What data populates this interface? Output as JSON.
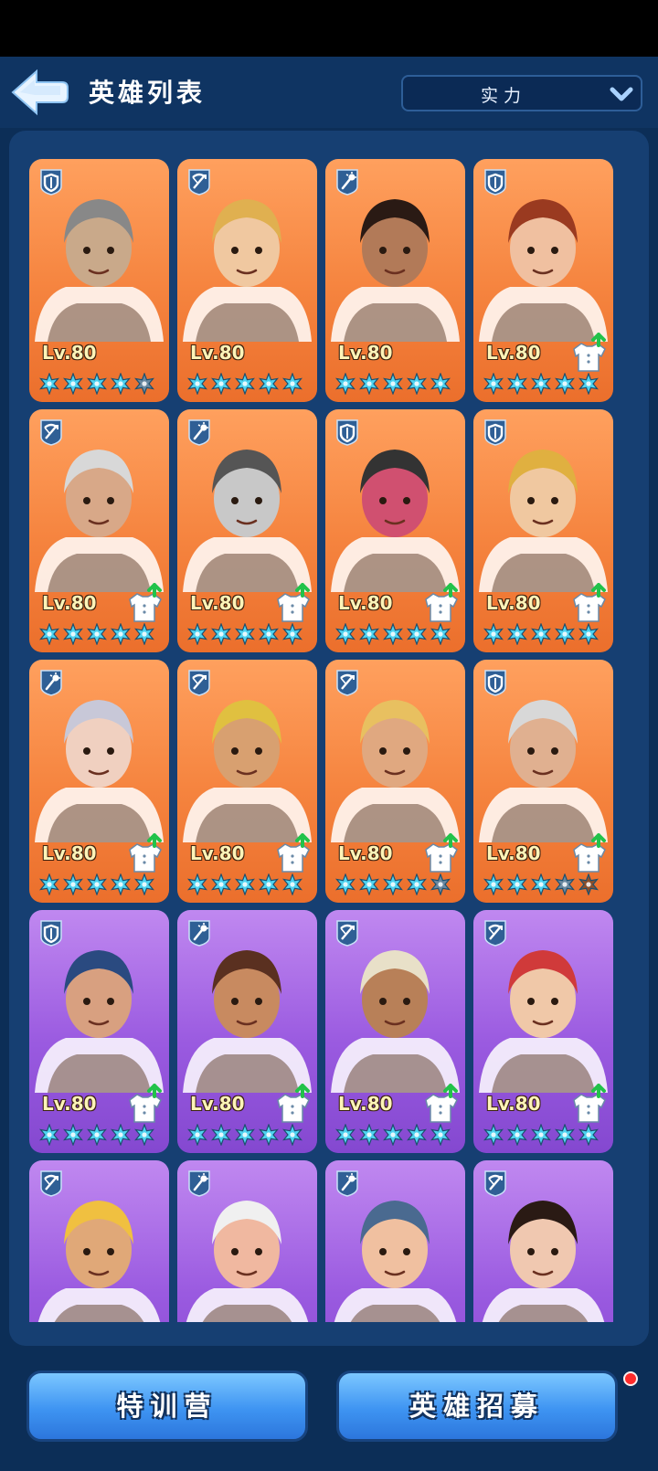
{
  "header": {
    "title": "英雄列表",
    "sort_value": "实力",
    "back_icon": "back-arrow-icon",
    "dropdown_icon": "chevron-down-icon"
  },
  "colors": {
    "orange_card": "#f5833e",
    "purple_card": "#9a5ae0",
    "star_filled": "#4fd3f0",
    "star_empty": "#8a4f2c",
    "level_text": "#fff4b8"
  },
  "heroes": [
    {
      "role": "shield",
      "level": "Lv.80",
      "stars": 4.5,
      "rarity": "orange",
      "gear": false,
      "hair": "#888",
      "skin": "#c9a98a"
    },
    {
      "role": "crossbow",
      "level": "Lv.80",
      "stars": 5,
      "rarity": "orange",
      "gear": false,
      "hair": "#e0b050",
      "skin": "#f0c8a0"
    },
    {
      "role": "wand",
      "level": "Lv.80",
      "stars": 5,
      "rarity": "orange",
      "gear": false,
      "hair": "#2a1a14",
      "skin": "#b27a58"
    },
    {
      "role": "shield",
      "level": "Lv.80",
      "stars": 5,
      "rarity": "orange",
      "gear": true,
      "hair": "#9a3a20",
      "skin": "#f0c0a0"
    },
    {
      "role": "crossbow",
      "level": "Lv.80",
      "stars": 5,
      "rarity": "orange",
      "gear": true,
      "hair": "#d8d8d8",
      "skin": "#d8a888"
    },
    {
      "role": "wand",
      "level": "Lv.80",
      "stars": 5,
      "rarity": "orange",
      "gear": true,
      "hair": "#555",
      "skin": "#c8c8c8"
    },
    {
      "role": "shield",
      "level": "Lv.80",
      "stars": 5,
      "rarity": "orange",
      "gear": true,
      "hair": "#333",
      "skin": "#d05070"
    },
    {
      "role": "shield",
      "level": "Lv.80",
      "stars": 5,
      "rarity": "orange",
      "gear": true,
      "hair": "#e0b040",
      "skin": "#f0c8a0"
    },
    {
      "role": "wand",
      "level": "Lv.80",
      "stars": 5,
      "rarity": "orange",
      "gear": true,
      "hair": "#c8c8d8",
      "skin": "#f0d0c0"
    },
    {
      "role": "crossbow",
      "level": "Lv.80",
      "stars": 5,
      "rarity": "orange",
      "gear": true,
      "hair": "#e0c040",
      "skin": "#d8a070"
    },
    {
      "role": "crossbow",
      "level": "Lv.80",
      "stars": 4.5,
      "rarity": "orange",
      "gear": true,
      "hair": "#e8c060",
      "skin": "#e0a880"
    },
    {
      "role": "shield",
      "level": "Lv.80",
      "stars": 3.5,
      "rarity": "orange",
      "gear": true,
      "hair": "#d8d8d8",
      "skin": "#e0b090"
    },
    {
      "role": "shield",
      "level": "Lv.80",
      "stars": 5,
      "rarity": "purple",
      "gear": true,
      "hair": "#2a4a80",
      "skin": "#d8a080"
    },
    {
      "role": "wand",
      "level": "Lv.80",
      "stars": 5,
      "rarity": "purple",
      "gear": true,
      "hair": "#5a3020",
      "skin": "#c88a60"
    },
    {
      "role": "crossbow",
      "level": "Lv.80",
      "stars": 5,
      "rarity": "purple",
      "gear": true,
      "hair": "#e8e0c8",
      "skin": "#b88058"
    },
    {
      "role": "crossbow",
      "level": "Lv.80",
      "stars": 5,
      "rarity": "purple",
      "gear": true,
      "hair": "#d03a3a",
      "skin": "#f0c8a8"
    },
    {
      "role": "crossbow",
      "level": "",
      "stars": 0,
      "rarity": "purple",
      "gear": false,
      "hair": "#f0c040",
      "skin": "#e0a878"
    },
    {
      "role": "wand",
      "level": "",
      "stars": 0,
      "rarity": "purple",
      "gear": false,
      "hair": "#f0f0f0",
      "skin": "#f0b8a0"
    },
    {
      "role": "wand",
      "level": "",
      "stars": 0,
      "rarity": "purple",
      "gear": false,
      "hair": "#4a6a90",
      "skin": "#f0c0a0"
    },
    {
      "role": "crossbow",
      "level": "",
      "stars": 0,
      "rarity": "purple",
      "gear": false,
      "hair": "#2a1a14",
      "skin": "#f0c8b0"
    }
  ],
  "footer": {
    "training_camp": "特训营",
    "recruit": "英雄招募"
  }
}
